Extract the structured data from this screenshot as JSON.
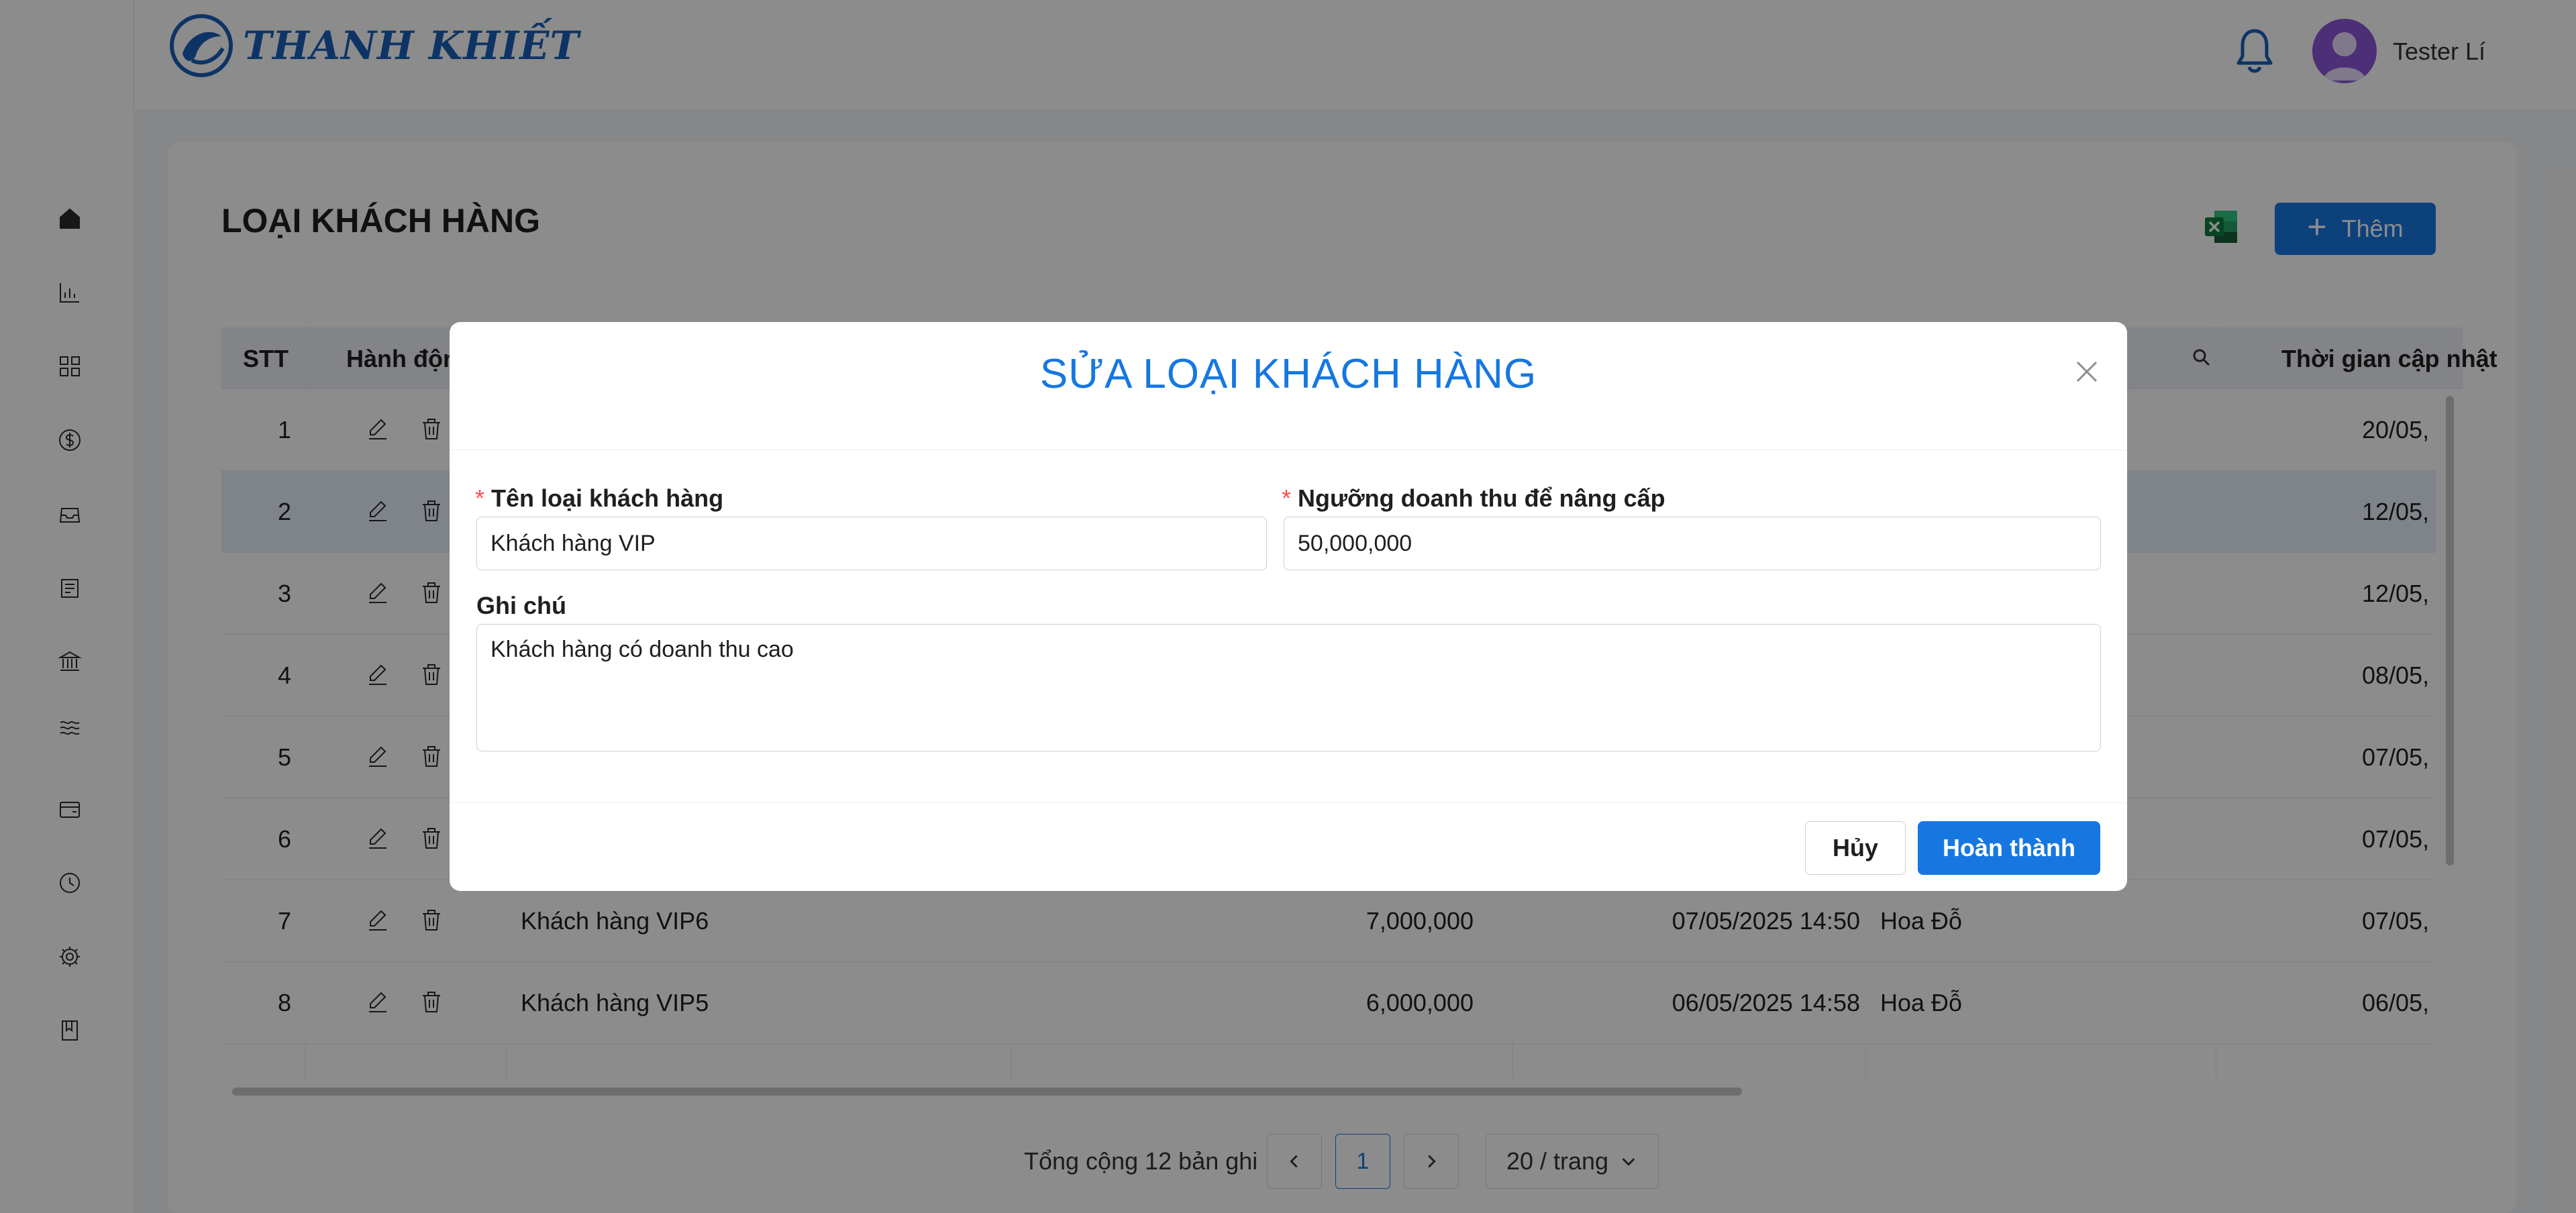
{
  "brand": {
    "name": "THANH KHIẾT"
  },
  "user": {
    "name": "Tester Lí"
  },
  "page": {
    "title": "LOẠI KHÁCH HÀNG",
    "add_label": "Thêm"
  },
  "table": {
    "headers": [
      "STT",
      "Hành động",
      "Thời gian cập nhật"
    ],
    "rows": [
      {
        "stt": "1",
        "name": "",
        "threshold": "",
        "created": "",
        "creator": "",
        "updated": "20/05,"
      },
      {
        "stt": "2",
        "name": "",
        "threshold": "",
        "created": "",
        "creator": "",
        "updated": "12/05,"
      },
      {
        "stt": "3",
        "name": "",
        "threshold": "",
        "created": "",
        "creator": "",
        "updated": "12/05,"
      },
      {
        "stt": "4",
        "name": "",
        "threshold": "",
        "created": "",
        "creator": "",
        "updated": "08/05,"
      },
      {
        "stt": "5",
        "name": "",
        "threshold": "",
        "created": "",
        "creator": "",
        "updated": "07/05,"
      },
      {
        "stt": "6",
        "name": "",
        "threshold": "",
        "created": "",
        "creator": "",
        "updated": "07/05,"
      },
      {
        "stt": "7",
        "name": "Khách hàng VIP6",
        "threshold": "7,000,000",
        "created": "07/05/2025 14:50",
        "creator": "Hoa Đỗ",
        "updated": "07/05,"
      },
      {
        "stt": "8",
        "name": "Khách hàng VIP5",
        "threshold": "6,000,000",
        "created": "06/05/2025 14:58",
        "creator": "Hoa Đỗ",
        "updated": "06/05,"
      }
    ]
  },
  "pagination": {
    "total_text": "Tổng cộng 12 bản ghi",
    "current_page": "1",
    "page_size": "20 / trang"
  },
  "modal": {
    "title": "SỬA LOẠI KHÁCH HÀNG",
    "name_label": "Tên loại khách hàng",
    "name_value": "Khách hàng VIP",
    "threshold_label": "Ngưỡng doanh thu để nâng cấp",
    "threshold_value": "50,000,000",
    "note_label": "Ghi chú",
    "note_value": "Khách hàng có doanh thu cao",
    "cancel_label": "Hủy",
    "ok_label": "Hoàn thành"
  },
  "sidebar": {
    "icons": [
      "home-icon",
      "chart-icon",
      "grid-icon",
      "dollar-icon",
      "inbox-icon",
      "receipt-icon",
      "bank-icon",
      "layers-icon",
      "wallet-icon",
      "history-icon",
      "gear-icon",
      "book-icon"
    ]
  },
  "colors": {
    "primary": "#1677e0",
    "brand": "#1b5fb8",
    "required": "#ff4d4f",
    "avatar": "#8a56d8"
  }
}
